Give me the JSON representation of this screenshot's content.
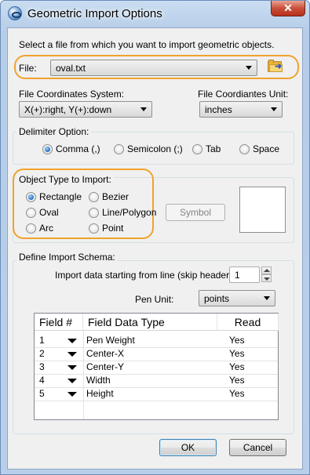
{
  "window": {
    "title": "Geometric Import Options",
    "close_glyph": "✕"
  },
  "file_section": {
    "instruction": "Select a file from which you want to import geometric objects.",
    "file_label": "File:",
    "file_value": "oval.txt"
  },
  "coordinates": {
    "system_label": "File Coordinates System:",
    "system_value": "X(+):right, Y(+):down",
    "unit_label": "File Coordiantes Unit:",
    "unit_value": "inches"
  },
  "delimiter": {
    "title": "Delimiter Option:",
    "options": [
      {
        "label": "Comma (,)",
        "checked": true
      },
      {
        "label": "Semicolon (;)",
        "checked": false
      },
      {
        "label": "Tab",
        "checked": false
      },
      {
        "label": "Space",
        "checked": false
      }
    ]
  },
  "object_type": {
    "title": "Object Type to Import:",
    "options": [
      {
        "label": "Rectangle",
        "checked": true
      },
      {
        "label": "Bezier",
        "checked": false
      },
      {
        "label": "Oval",
        "checked": false
      },
      {
        "label": "Line/Polygon",
        "checked": false
      },
      {
        "label": "Arc",
        "checked": false
      },
      {
        "label": "Point",
        "checked": false
      }
    ],
    "symbol_button": "Symbol"
  },
  "schema": {
    "title": "Define Import Schema:",
    "start_line_label": "Import data starting from line (skip header):",
    "start_line_value": "1",
    "pen_unit_label": "Pen Unit:",
    "pen_unit_value": "points",
    "columns": [
      "Field #",
      "Field Data Type",
      "Read"
    ],
    "rows": [
      {
        "num": "1",
        "type": "Pen Weight",
        "read": "Yes"
      },
      {
        "num": "2",
        "type": "Center-X",
        "read": "Yes"
      },
      {
        "num": "3",
        "type": "Center-Y",
        "read": "Yes"
      },
      {
        "num": "4",
        "type": "Width",
        "read": "Yes"
      },
      {
        "num": "5",
        "type": "Height",
        "read": "Yes"
      }
    ]
  },
  "buttons": {
    "ok": "OK",
    "cancel": "Cancel"
  },
  "colors": {
    "highlight": "#f0a22e",
    "selection": "#1d6bbf"
  }
}
